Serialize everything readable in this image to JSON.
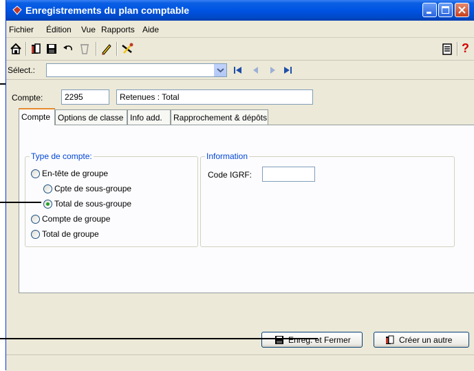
{
  "window": {
    "title": "Enregistrements du plan comptable"
  },
  "menu": [
    "Fichier",
    "Édition",
    "Vue",
    "Rapports",
    "Aide"
  ],
  "toolbar": {
    "icons": [
      "home-icon",
      "open-folder-icon",
      "save-icon",
      "undo-icon",
      "delete-icon",
      "pencil-icon",
      "tools-icon",
      "report-icon",
      "help-icon"
    ],
    "help_label": "?"
  },
  "select_bar": {
    "label": "Sélect.:",
    "value": ""
  },
  "account": {
    "label": "Compte:",
    "number": "2295",
    "name": "Retenues : Total"
  },
  "tabs": [
    "Compte",
    "Options de classe",
    "Info add.",
    "Rapprochement & dépôts"
  ],
  "type_group": {
    "legend": "Type de compte:",
    "options": [
      {
        "label": "En-tête de groupe",
        "selected": false
      },
      {
        "label": "Cpte de sous-groupe",
        "selected": false
      },
      {
        "label": "Total de sous-groupe",
        "selected": true
      },
      {
        "label": "Compte de groupe",
        "selected": false
      },
      {
        "label": "Total de groupe",
        "selected": false
      }
    ]
  },
  "info_group": {
    "legend": "Information",
    "code_label": "Code IGRF:",
    "code_value": ""
  },
  "buttons": {
    "save_close": "Enreg. et Fermer",
    "create_other": "Créer un autre"
  },
  "colors": {
    "title_blue": "#0054e3",
    "radio_dot": "#21a121",
    "tab_accent": "#e68b2c",
    "help_red": "#d40000"
  }
}
